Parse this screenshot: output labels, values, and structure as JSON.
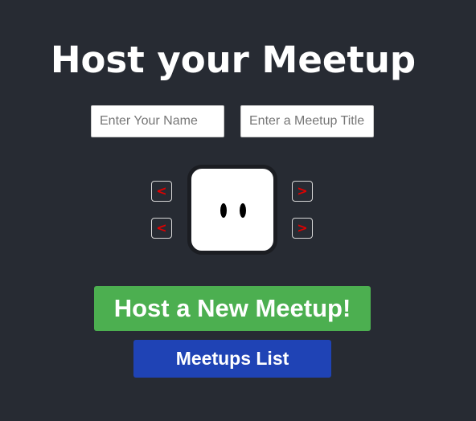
{
  "header": {
    "title": "Host your Meetup"
  },
  "form": {
    "name_placeholder": "Enter Your Name",
    "title_placeholder": "Enter a Meetup Title"
  },
  "avatar_picker": {
    "prev_glyph": "<",
    "next_glyph": ">",
    "arrow_color": "#e00000"
  },
  "actions": {
    "host_label": "Host a New Meetup!",
    "list_label": "Meetups List"
  },
  "colors": {
    "background": "#272b33",
    "host_button": "#4caf50",
    "list_button": "#1f43b5"
  }
}
